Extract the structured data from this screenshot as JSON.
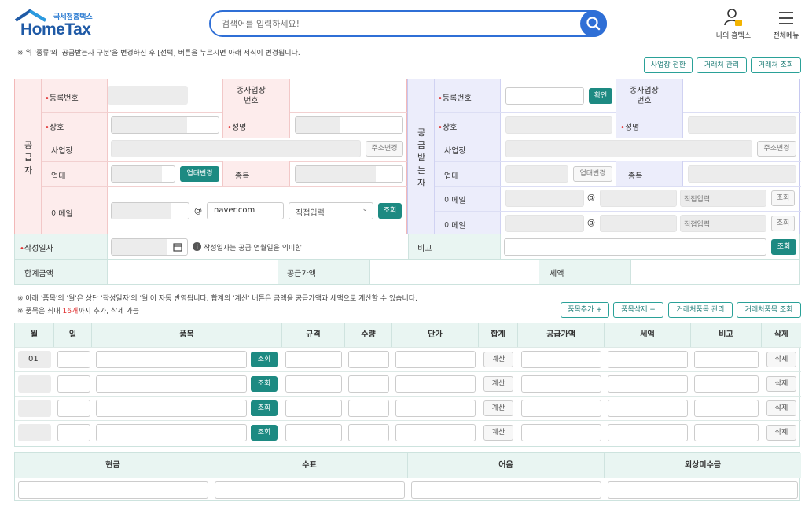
{
  "header": {
    "logo_sub": "국세청홈택스",
    "logo_main": "HomeTax",
    "search_placeholder": "검색어를 입력하세요!",
    "my_hometax": "나의 홈텍스",
    "all_menu": "전체메뉴"
  },
  "notice_top": "※ 위 '종류'와 '공급받는자 구분'을 변경하신 후 [선택] 버튼을 누르시면 아래 서식이 변경됩니다.",
  "top_buttons": {
    "switch_biz": "사업장 전환",
    "partner_manage": "거래처 관리",
    "partner_search": "거래처 조회"
  },
  "supplier": {
    "side_label": "공\n급\n자",
    "reg_no": "등록번호",
    "sub_biz_no": "종사업장\n번호",
    "company": "상호",
    "name": "성명",
    "address": "사업장",
    "address_change": "주소변경",
    "biz_type": "업태",
    "biz_type_change": "업태변경",
    "item": "종목",
    "email": "이메일",
    "at": "@",
    "email_domain": "naver.com",
    "direct_input": "직접입력",
    "search": "조회"
  },
  "receiver": {
    "side_label": "공\n급\n받\n는\n자",
    "reg_no": "등록번호",
    "confirm": "확인",
    "sub_biz_no": "종사업장\n번호",
    "company": "상호",
    "name": "성명",
    "address": "사업장",
    "address_change": "주소변경",
    "biz_type": "업태",
    "biz_type_change": "업태변경",
    "item": "종목",
    "email1": "이메일",
    "email2": "이메일",
    "at": "@",
    "direct_input": "직접입력",
    "search": "조회"
  },
  "date_row": {
    "label": "작성일자",
    "hint": "작성일자는 공급 연월일을 의미함",
    "remark": "비고",
    "search": "조회"
  },
  "total_row": {
    "total": "합계금액",
    "supply": "공급가액",
    "tax": "세액"
  },
  "notice_items1": "※ 아래 '품목'의 '월'은 상단 '작성일자'의 '월'이 자동 반영됩니다. 합계의 '계산' 버튼은 금액을 공급가액과 세액으로 계산할 수 있습니다.",
  "notice_items2_pre": "※ 품목은 최대 ",
  "notice_items2_num": "16개",
  "notice_items2_post": "까지 추가, 삭제 가능",
  "item_buttons": {
    "add": "품목추가 +",
    "delete": "품목삭제 −",
    "manage": "거래처품목 관리",
    "search": "거래처품목 조회"
  },
  "item_columns": [
    "월",
    "일",
    "품목",
    "규격",
    "수량",
    "단가",
    "합계",
    "공급가액",
    "세액",
    "비고",
    "삭제"
  ],
  "item_rows": [
    {
      "month": "01",
      "search": "조회",
      "calc": "계산",
      "delete": "삭제"
    },
    {
      "month": "",
      "search": "조회",
      "calc": "계산",
      "delete": "삭제"
    },
    {
      "month": "",
      "search": "조회",
      "calc": "계산",
      "delete": "삭제"
    },
    {
      "month": "",
      "search": "조회",
      "calc": "계산",
      "delete": "삭제"
    }
  ],
  "payment_columns": [
    "현금",
    "수표",
    "어음",
    "외상미수금"
  ],
  "colors": {
    "accent": "#1d8a82",
    "search_border": "#2f6fd6",
    "supplier_bg": "#fdecec",
    "receiver_bg": "#ecedfb",
    "required": "#e03030"
  }
}
